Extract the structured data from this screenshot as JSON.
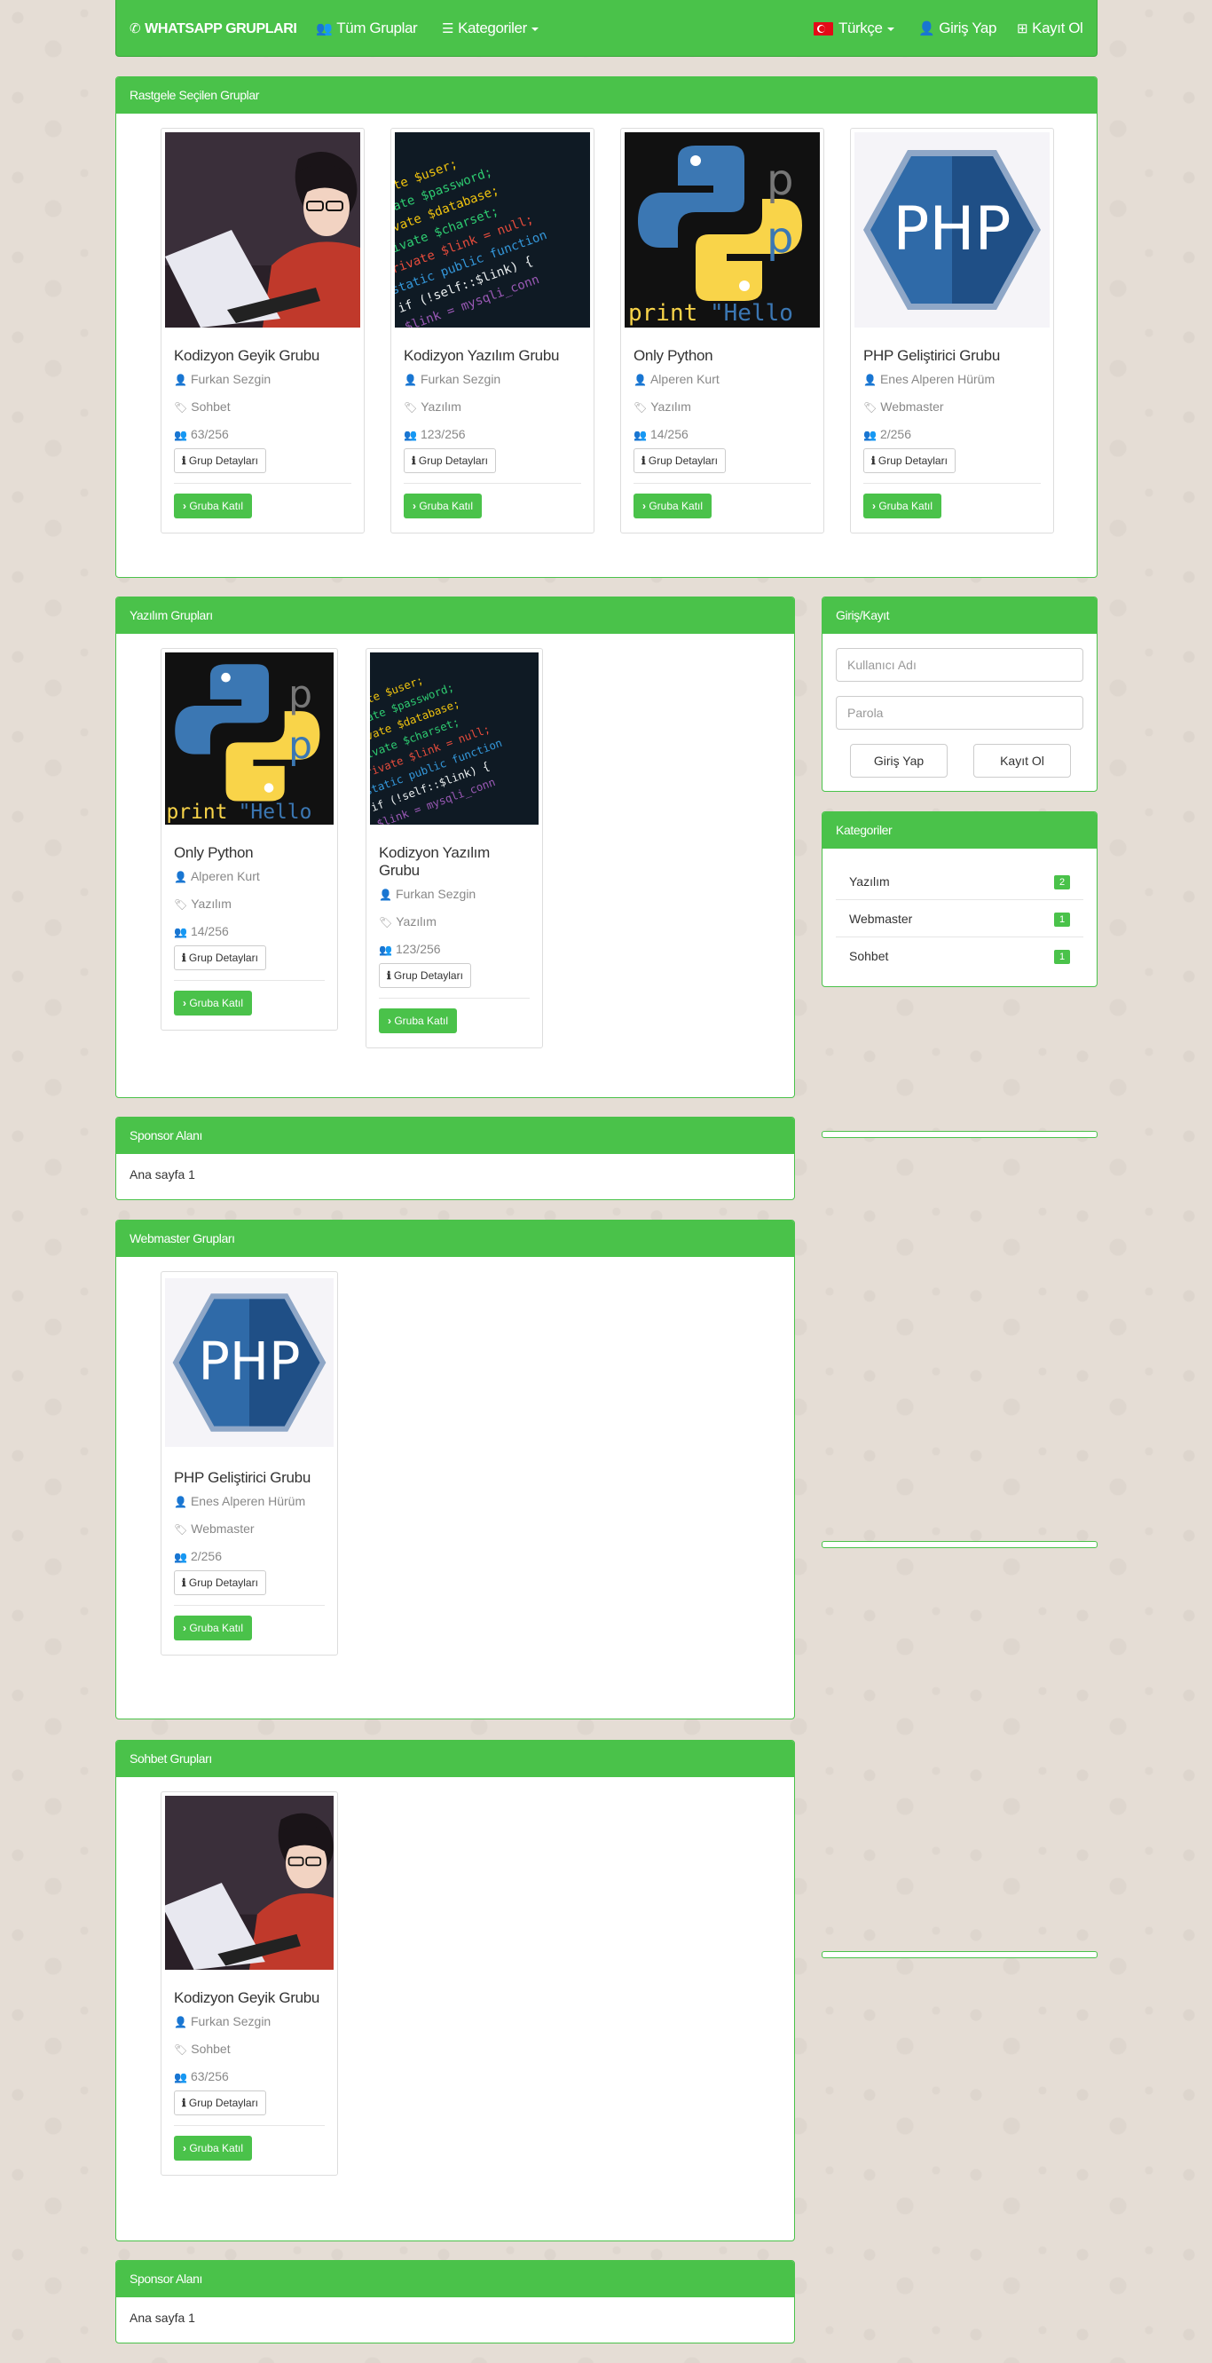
{
  "nav": {
    "brand": "WHATSAPP GRUPLARI",
    "all_groups": "Tüm Gruplar",
    "categories": "Kategoriler",
    "language": "Türkçe",
    "login": "Giriş Yap",
    "register": "Kayıt Ol"
  },
  "colors": {
    "accent": "#4ac24a",
    "background": "#e5ddd5"
  },
  "labels": {
    "detail_button": "Grup Detayları",
    "join_button": "Gruba Katıl"
  },
  "random_section": {
    "title": "Rastgele Seçilen Gruplar",
    "cards": [
      {
        "title": "Kodizyon Geyik Grubu",
        "owner": "Furkan Sezgin",
        "category": "Sohbet",
        "members": "63/256",
        "image": "anime-coder"
      },
      {
        "title": "Kodizyon Yazılım Grubu",
        "owner": "Furkan Sezgin",
        "category": "Yazılım",
        "members": "123/256",
        "image": "code-screen"
      },
      {
        "title": "Only Python",
        "owner": "Alperen Kurt",
        "category": "Yazılım",
        "members": "14/256",
        "image": "python-logo"
      },
      {
        "title": "PHP Geliştirici Grubu",
        "owner": "Enes Alperen Hürüm",
        "category": "Webmaster",
        "members": "2/256",
        "image": "php-logo"
      }
    ]
  },
  "software_section": {
    "title": "Yazılım Grupları",
    "cards": [
      {
        "title": "Only Python",
        "owner": "Alperen Kurt",
        "category": "Yazılım",
        "members": "14/256",
        "image": "python-logo"
      },
      {
        "title": "Kodizyon Yazılım Grubu",
        "owner": "Furkan Sezgin",
        "category": "Yazılım",
        "members": "123/256",
        "image": "code-screen"
      }
    ]
  },
  "sponsor_1": {
    "title": "Sponsor Alanı",
    "text": "Ana sayfa 1"
  },
  "webmaster_section": {
    "title": "Webmaster Grupları",
    "cards": [
      {
        "title": "PHP Geliştirici Grubu",
        "owner": "Enes Alperen Hürüm",
        "category": "Webmaster",
        "members": "2/256",
        "image": "php-logo"
      }
    ]
  },
  "chat_section": {
    "title": "Sohbet Grupları",
    "cards": [
      {
        "title": "Kodizyon Geyik Grubu",
        "owner": "Furkan Sezgin",
        "category": "Sohbet",
        "members": "63/256",
        "image": "anime-coder"
      }
    ]
  },
  "sponsor_2": {
    "title": "Sponsor Alanı",
    "text": "Ana sayfa 1"
  },
  "login_panel": {
    "title": "Giriş/Kayıt",
    "username_placeholder": "Kullanıcı Adı",
    "password_placeholder": "Parola",
    "login_button": "Giriş Yap",
    "register_button": "Kayıt Ol"
  },
  "categories_panel": {
    "title": "Kategoriler",
    "items": [
      {
        "name": "Yazılım",
        "count": "2"
      },
      {
        "name": "Webmaster",
        "count": "1"
      },
      {
        "name": "Sohbet",
        "count": "1"
      }
    ]
  }
}
